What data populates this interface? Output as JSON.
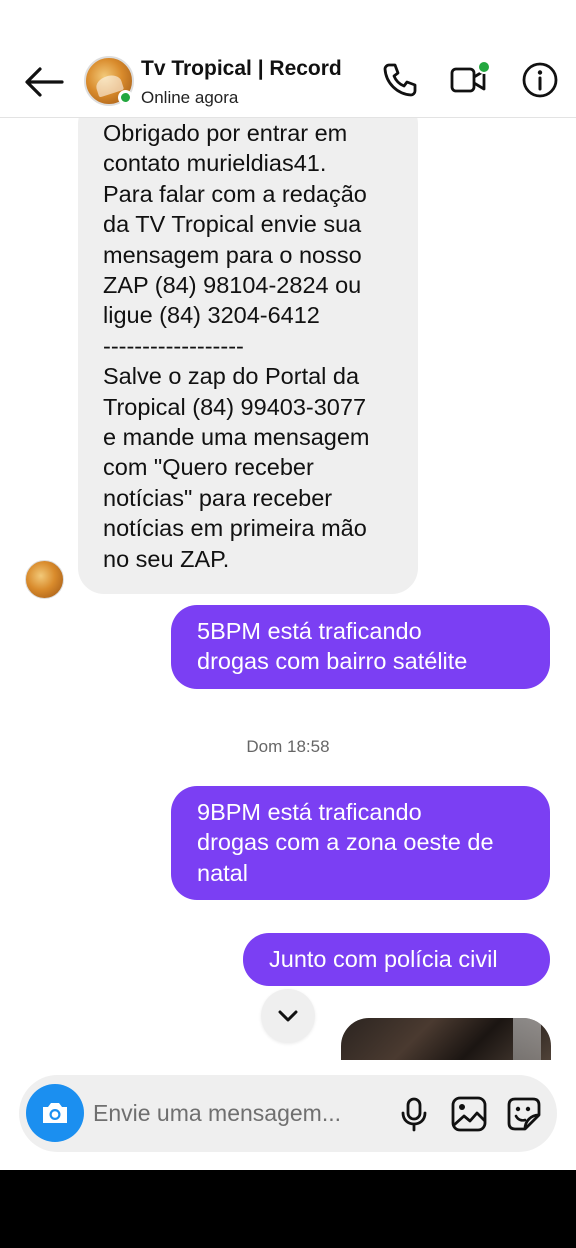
{
  "header": {
    "contact_name": "Tv Tropical | Record",
    "status": "Online agora",
    "icons": [
      "back-arrow-icon",
      "phone-icon",
      "video-call-icon",
      "info-icon"
    ]
  },
  "messages": {
    "incoming": {
      "lines": [
        "Obrigado por entrar em",
        "contato murieldias41.",
        "Para falar com a redação",
        "da TV Tropical envie sua",
        "mensagem para o nosso",
        "ZAP (84) 98104-2824 ou",
        "ligue (84) 3204-6412",
        "------------------",
        "Salve o zap do Portal da",
        "Tropical (84) 99403-3077",
        "e mande uma mensagem",
        "com \"Quero receber",
        "notícias\" para receber",
        "notícias em primeira mão",
        "no seu ZAP."
      ]
    },
    "outgoing_1": {
      "lines": [
        "5BPM está traficando",
        "drogas com bairro satélite"
      ]
    },
    "timestamp": "Dom 18:58",
    "outgoing_2": {
      "lines": [
        "9BPM está traficando",
        "drogas com a zona oeste de",
        "natal"
      ]
    },
    "outgoing_3": {
      "lines": [
        "Junto com polícia civil"
      ]
    }
  },
  "composer": {
    "placeholder": "Envie uma mensagem...",
    "icons": [
      "camera-icon",
      "microphone-icon",
      "gallery-icon",
      "sticker-icon"
    ]
  },
  "colors": {
    "outgoing_bubble": "#7b3ff3",
    "incoming_bubble": "#efefef",
    "online": "#23a73f",
    "camera_button": "#1b8ff0"
  }
}
